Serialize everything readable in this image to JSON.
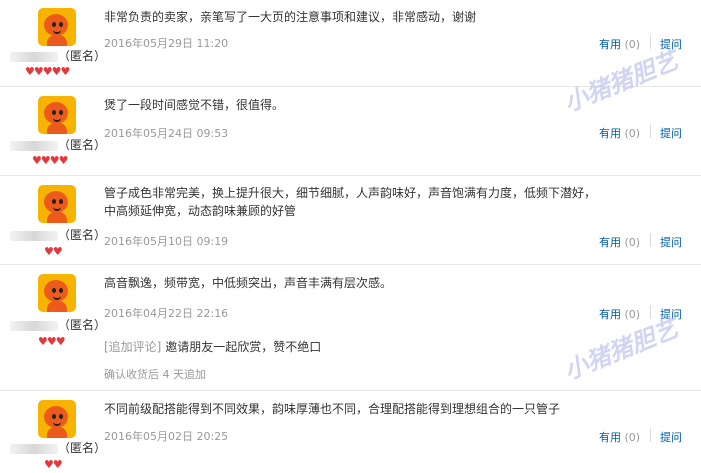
{
  "reviews": [
    {
      "content": "非常负责的卖家，亲笔写了一大页的注意事项和建议，非常感动，谢谢",
      "date": "2016年05月29日 11:20",
      "nickname_suffix": "（匿名）",
      "rating": 5,
      "useful_label": "有用",
      "useful_count": "(0)",
      "reply_label": "提问"
    },
    {
      "content": "煲了一段时间感觉不错，很值得。",
      "date": "2016年05月24日 09:53",
      "nickname_suffix": "（匿名）",
      "rating": 4,
      "useful_label": "有用",
      "useful_count": "(0)",
      "reply_label": "提问"
    },
    {
      "content": "管子成色非常完美，换上提升很大，细节细腻，人声韵味好，声音饱满有力度，低频下潜好，中高频延伸宽，动态韵味兼顾的好管",
      "date": "2016年05月10日 09:19",
      "nickname_suffix": "（匿名）",
      "rating": 2,
      "useful_label": "有用",
      "useful_count": "(0)",
      "reply_label": "提问"
    },
    {
      "content": "高音飘逸，频带宽，中低频突出，声音丰满有层次感。",
      "date": "2016年04月22日 22:16",
      "nickname_suffix": "（匿名）",
      "rating": 3,
      "useful_label": "有用",
      "useful_count": "(0)",
      "reply_label": "提问",
      "append_tag": "[追加评论]",
      "append_content": "邀请朋友一起欣赏，赞不绝口",
      "append_note": "确认收货后 4 天追加"
    },
    {
      "content": "不同前级配搭能得到不同效果，韵味厚薄也不同，合理配搭能得到理想组合的一只管子",
      "date": "2016年05月02日 20:25",
      "nickname_suffix": "（匿名）",
      "rating": 2,
      "useful_label": "有用",
      "useful_count": "(0)",
      "reply_label": "提问"
    }
  ],
  "watermark": "小猪猪胆艺",
  "colors": {
    "link": "#005ea7",
    "heart": "#e4393c",
    "muted": "#999999",
    "avatar_bg": "#f6b400",
    "avatar_face": "#ec5a1c"
  }
}
